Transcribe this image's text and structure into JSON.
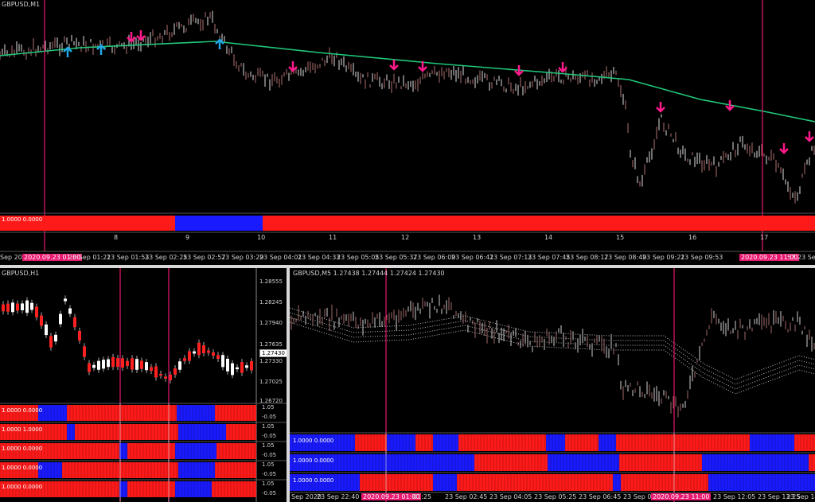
{
  "top": {
    "title": "GBPUSD,M1",
    "indicator_label": "1.0000 0.0000",
    "date_axis": [
      "Sep 202",
      "2020.09.23 01:00",
      "23 Sep 01:21",
      "23 Sep 01:53",
      "23 Sep 02:25",
      "23 Sep 02:57",
      "23 Sep 03:29",
      "23 Sep 04:01",
      "23 Sep 04:33",
      "23 Sep 05:05",
      "23 Sep 05:37",
      "23 Sep 06:09",
      "23 Sep 06:41",
      "23 Sep 07:13",
      "23 Sep 07:45",
      "23 Sep 08:17",
      "23 Sep 08:49",
      "23 Sep 09:21",
      "23 Sep 09:53",
      "2020.09.23 11:00",
      "57",
      "23 Sep"
    ],
    "hour_axis": [
      "8",
      "9",
      "10",
      "11",
      "12",
      "13",
      "14",
      "15",
      "16",
      "17"
    ]
  },
  "bl": {
    "title": "GBPUSD,H1",
    "prices": [
      "1.28555",
      "1.28245",
      "1.27940",
      "1.27635",
      "1.27430",
      "1.27330",
      "1.27025",
      "1.26720"
    ],
    "current_price": "1.27430",
    "rows": [
      {
        "label": "1.0000 0.0000",
        "scale": [
          "1.05",
          "-0.05"
        ]
      },
      {
        "label": "1.0000 1.0000",
        "scale": [
          "1.05",
          "-0.05"
        ]
      },
      {
        "label": "1.0000 0.0000",
        "scale": [
          "1.05",
          "-0.05"
        ]
      },
      {
        "label": "1.0000 0.0000",
        "scale": [
          "1.05",
          "-0.05"
        ]
      },
      {
        "label": "1.0000 0.0000",
        "scale": [
          "1.05",
          "-0.05"
        ]
      }
    ]
  },
  "br": {
    "title": "GBPUSD,M5  1.27438 1.27444 1.27424 1.27430",
    "rows": [
      "1.0000 0.0000",
      "1.0000 0.0000",
      "1.0000 0.0000"
    ],
    "date_axis": [
      "Sep 2020",
      "23 Sep 22:40",
      "2020.09.23 01:00",
      "01:25",
      "23 Sep 02:45",
      "23 Sep 04:05",
      "23 Sep 05:25",
      "23 Sep 06:45",
      "23 Sep 08:05",
      "2020.09.23 11:00",
      "23 Sep 12:05",
      "23 Sep 13:25",
      "23 Sep 14:45"
    ]
  },
  "colors": {
    "red": "#ff1a1a",
    "blue": "#1a1aff",
    "magenta": "#e8176f",
    "ma": "#20c87a",
    "up": "#1ea8e6",
    "down": "#ff1a8c"
  }
}
